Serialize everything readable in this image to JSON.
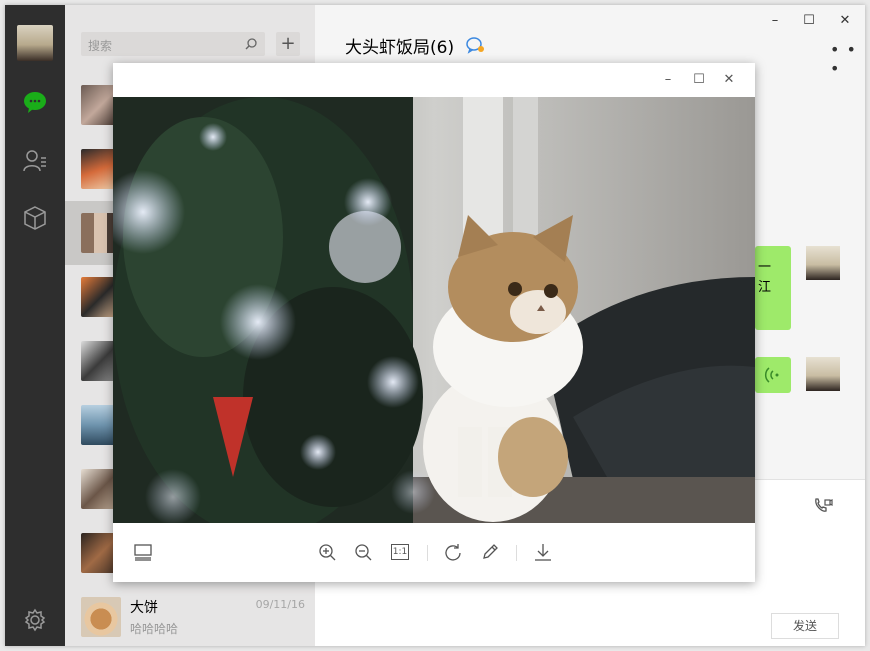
{
  "search": {
    "placeholder": "搜索"
  },
  "add_label": "+",
  "chat": {
    "title": "大头虾饭局(6)",
    "more": "• • •",
    "bubble1_text": "一\n江",
    "send_label": "发送"
  },
  "window_controls": {
    "min": "–",
    "max": "☐",
    "close": "✕"
  },
  "contacts": [
    {
      "name": "",
      "time": "",
      "preview": ""
    },
    {
      "name": "",
      "time": "",
      "preview": ""
    },
    {
      "name": "",
      "time": "",
      "preview": ""
    },
    {
      "name": "",
      "time": "",
      "preview": ""
    },
    {
      "name": "",
      "time": "",
      "preview": ""
    },
    {
      "name": "",
      "time": "",
      "preview": ""
    },
    {
      "name": "",
      "time": "",
      "preview": ""
    },
    {
      "name": "",
      "time": "",
      "preview": ""
    },
    {
      "name": "大饼",
      "time": "09/11/16",
      "preview": "哈哈哈哈"
    }
  ],
  "viewer": {
    "toolbar": [
      "thumbnails",
      "zoom-in",
      "zoom-out",
      "actual-size",
      "rotate",
      "edit",
      "download"
    ],
    "actual_size_label": "1:1"
  },
  "colors": {
    "rail": "#2e2e2e",
    "accent_green": "#1aad19",
    "bubble": "#9eea6a"
  }
}
